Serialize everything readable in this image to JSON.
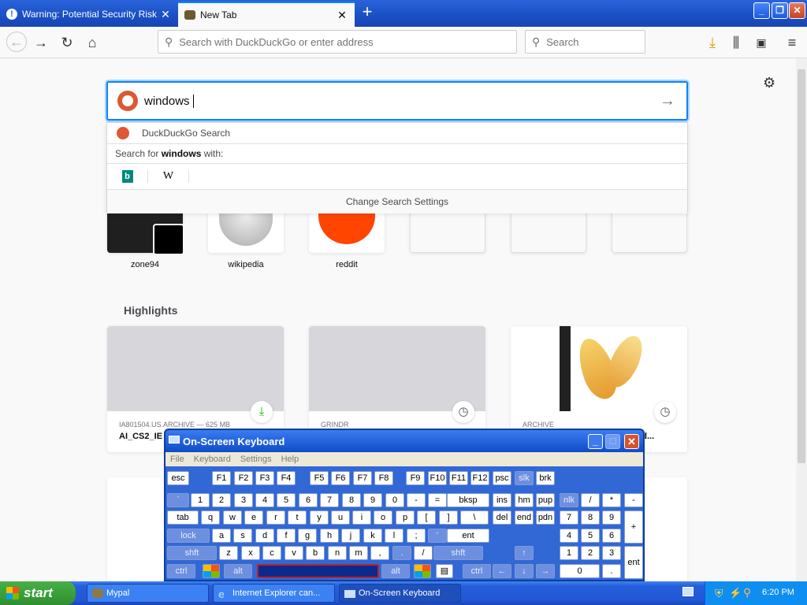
{
  "browser": {
    "tabs": [
      {
        "label": "Warning: Potential Security Risk Ah"
      },
      {
        "label": "New Tab"
      }
    ],
    "url_placeholder": "Search with DuckDuckGo or enter address",
    "search_placeholder": "Search"
  },
  "newtab": {
    "search_value": "windows",
    "dropdown": {
      "engine_label": "DuckDuckGo Search",
      "search_for_prefix": "Search for ",
      "search_for_term": "windows",
      "search_for_suffix": " with:",
      "change_settings": "Change Search Settings",
      "engines": [
        "b",
        "W"
      ]
    },
    "top_sites": [
      {
        "label": "zone94"
      },
      {
        "label": "wikipedia"
      },
      {
        "label": "reddit"
      },
      {
        "label": ""
      },
      {
        "label": ""
      },
      {
        "label": ""
      }
    ],
    "highlights_title": "Highlights",
    "highlights": [
      {
        "source": "IA801504.US.ARCHIVE — 625 MB",
        "title": "AI_CS2_IE",
        "badge": "download"
      },
      {
        "source": "GRINDR",
        "title": "",
        "badge": "clock"
      },
      {
        "source": "ARCHIVE",
        "title": "...dard...",
        "badge": "clock"
      }
    ]
  },
  "osk": {
    "title": "On-Screen Keyboard",
    "menu": [
      "File",
      "Keyboard",
      "Settings",
      "Help"
    ],
    "row0": [
      "esc",
      "F1",
      "F2",
      "F3",
      "F4",
      "F5",
      "F6",
      "F7",
      "F8",
      "F9",
      "F10",
      "F11",
      "F12",
      "psc",
      "slk",
      "brk"
    ],
    "row1": [
      "`",
      "1",
      "2",
      "3",
      "4",
      "5",
      "6",
      "7",
      "8",
      "9",
      "0",
      "-",
      "=",
      "bksp",
      "ins",
      "hm",
      "pup",
      "nlk",
      "/",
      "*",
      "-"
    ],
    "row2": [
      "tab",
      "q",
      "w",
      "e",
      "r",
      "t",
      "y",
      "u",
      "i",
      "o",
      "p",
      "[",
      "]",
      "\\",
      "del",
      "end",
      "pdn",
      "7",
      "8",
      "9",
      "+"
    ],
    "row3": [
      "lock",
      "a",
      "s",
      "d",
      "f",
      "g",
      "h",
      "j",
      "k",
      "l",
      ";",
      "'",
      "ent",
      "4",
      "5",
      "6"
    ],
    "row4": [
      "shft",
      "z",
      "x",
      "c",
      "v",
      "b",
      "n",
      "m",
      ",",
      ".",
      "/",
      "shft",
      "1",
      "2",
      "3",
      "ent"
    ],
    "row5": [
      "ctrl",
      "alt",
      "alt",
      "ctrl",
      "0",
      "."
    ]
  },
  "taskbar": {
    "start": "start",
    "items": [
      {
        "label": "Mypal"
      },
      {
        "label": "Internet Explorer can..."
      },
      {
        "label": "On-Screen Keyboard"
      }
    ],
    "clock": "6:20 PM"
  }
}
